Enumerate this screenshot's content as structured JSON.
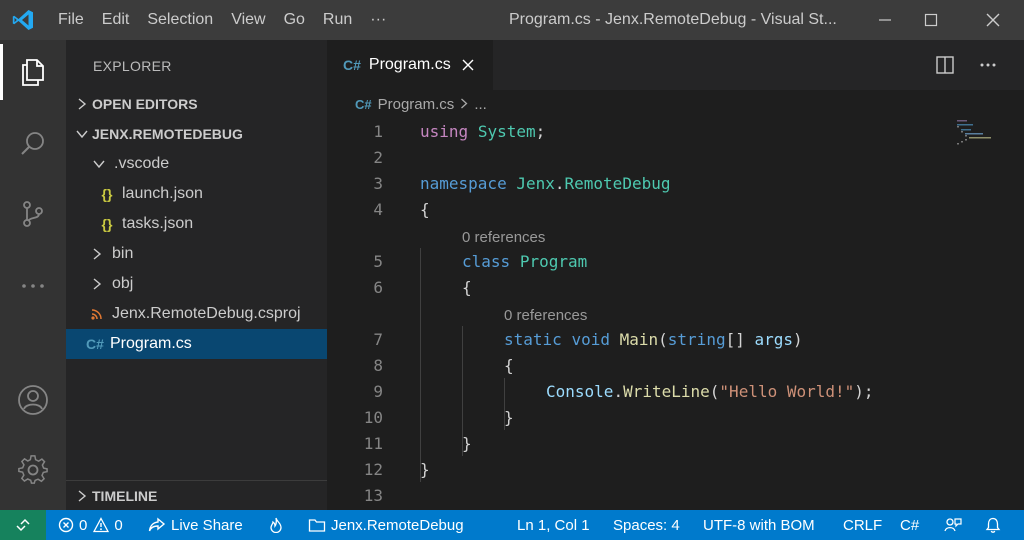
{
  "titlebar": {
    "menu": [
      "File",
      "Edit",
      "Selection",
      "View",
      "Go",
      "Run",
      "···"
    ],
    "window_title": "Program.cs - Jenx.RemoteDebug - Visual St..."
  },
  "sidebar": {
    "title": "EXPLORER",
    "open_editors": "OPEN EDITORS",
    "project": "JENX.REMOTEDEBUG",
    "tree": [
      {
        "label": ".vscode",
        "icon": "chevron-down-icon"
      },
      {
        "label": "launch.json",
        "icon": "json-file-icon"
      },
      {
        "label": "tasks.json",
        "icon": "json-file-icon"
      },
      {
        "label": "bin",
        "icon": "chevron-right-icon"
      },
      {
        "label": "obj",
        "icon": "chevron-right-icon"
      },
      {
        "label": "Jenx.RemoteDebug.csproj",
        "icon": "rss-file-icon"
      },
      {
        "label": "Program.cs",
        "icon": "csharp-file-icon",
        "selected": true
      }
    ],
    "timeline": "TIMELINE"
  },
  "editor": {
    "tab_label": "Program.cs",
    "breadcrumb_file": "Program.cs",
    "breadcrumb_more": "...",
    "line_numbers": [
      "1",
      "2",
      "3",
      "4",
      "5",
      "6",
      "7",
      "8",
      "9",
      "10",
      "11",
      "12",
      "13"
    ],
    "codelens": [
      "0 references",
      "0 references"
    ],
    "code": {
      "using_kw": "using",
      "using_ns": "System",
      "semicolon": ";",
      "namespace_kw": "namespace",
      "ns_part1": "Jenx",
      "dot": ".",
      "ns_part2": "RemoteDebug",
      "open_brace": "{",
      "close_brace": "}",
      "class_kw": "class",
      "class_name": "Program",
      "static_kw": "static",
      "void_kw": "void",
      "method_name": "Main",
      "paren_open": "(",
      "string_kw": "string",
      "brackets": "[]",
      "param": "args",
      "paren_close": ")",
      "console": "Console",
      "writeline": "WriteLine",
      "literal": "\"Hello World!\"",
      "stmt_end": ");"
    }
  },
  "statusbar": {
    "errors": "0",
    "warnings": "0",
    "live_share": "Live Share",
    "folder": "Jenx.RemoteDebug",
    "position": "Ln 1, Col 1",
    "spaces": "Spaces: 4",
    "encoding": "UTF-8 with BOM",
    "eol": "CRLF",
    "language": "C#"
  },
  "colors": {
    "accent": "#007acc",
    "remote": "#16825d",
    "selection": "#094771",
    "vscode_logo": "#23a9f2"
  }
}
